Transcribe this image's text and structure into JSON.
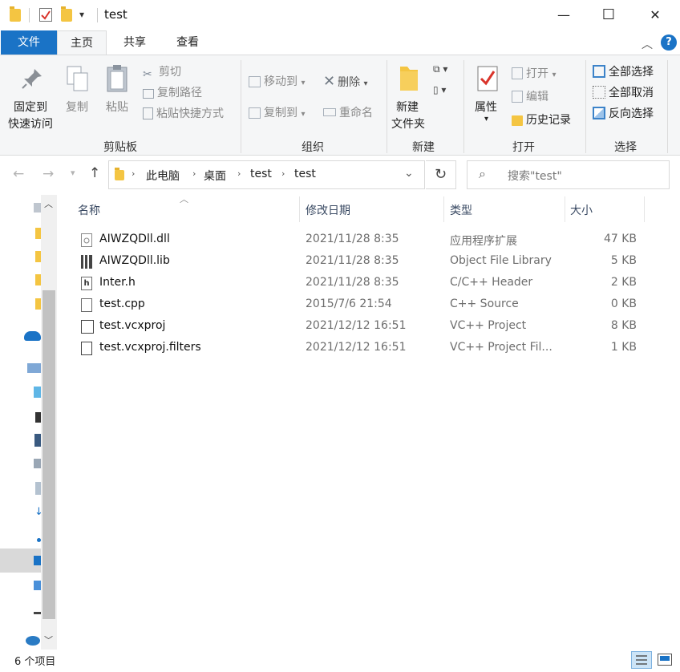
{
  "window": {
    "title": "test",
    "minimize": "—",
    "maximize": "☐",
    "close": "✕"
  },
  "tabs": {
    "file": "文件",
    "home": "主页",
    "share": "共享",
    "view": "查看"
  },
  "ribbon": {
    "clipboard": {
      "pin_line1": "固定到",
      "pin_line2": "快速访问",
      "copy": "复制",
      "paste": "粘贴",
      "cut": "剪切",
      "copy_path": "复制路径",
      "paste_shortcut": "粘贴快捷方式",
      "label": "剪贴板"
    },
    "organize": {
      "move_to": "移动到",
      "copy_to": "复制到",
      "delete": "删除",
      "rename": "重命名",
      "label": "组织"
    },
    "new": {
      "new_folder_line1": "新建",
      "new_folder_line2": "文件夹",
      "label": "新建"
    },
    "open": {
      "properties": "属性",
      "open": "打开",
      "edit": "编辑",
      "history": "历史记录",
      "label": "打开"
    },
    "select": {
      "select_all": "全部选择",
      "select_none": "全部取消",
      "invert": "反向选择",
      "label": "选择"
    }
  },
  "address": {
    "crumbs": [
      "此电脑",
      "桌面",
      "test",
      "test"
    ],
    "search_placeholder": "搜索\"test\""
  },
  "columns": {
    "name": "名称",
    "date": "修改日期",
    "type": "类型",
    "size": "大小"
  },
  "files": [
    {
      "name": "AIWZQDll.dll",
      "date": "2021/11/28 8:35",
      "type": "应用程序扩展",
      "size": "47 KB",
      "icon": "dll-file-icon"
    },
    {
      "name": "AIWZQDll.lib",
      "date": "2021/11/28 8:35",
      "type": "Object File Library",
      "size": "5 KB",
      "icon": "lib-file-icon"
    },
    {
      "name": "Inter.h",
      "date": "2021/11/28 8:35",
      "type": "C/C++ Header",
      "size": "2 KB",
      "icon": "header-file-icon"
    },
    {
      "name": "test.cpp",
      "date": "2015/7/6 21:54",
      "type": "C++ Source",
      "size": "0 KB",
      "icon": "cpp-file-icon"
    },
    {
      "name": "test.vcxproj",
      "date": "2021/12/12 16:51",
      "type": "VC++ Project",
      "size": "8 KB",
      "icon": "vcxproj-file-icon"
    },
    {
      "name": "test.vcxproj.filters",
      "date": "2021/12/12 16:51",
      "type": "VC++ Project Fil...",
      "size": "1 KB",
      "icon": "filters-file-icon"
    }
  ],
  "status": {
    "count": "6 个项目"
  },
  "colors": {
    "accent": "#1a73c6",
    "folder": "#f4c542",
    "ribbon_bg": "#f5f6f7"
  }
}
